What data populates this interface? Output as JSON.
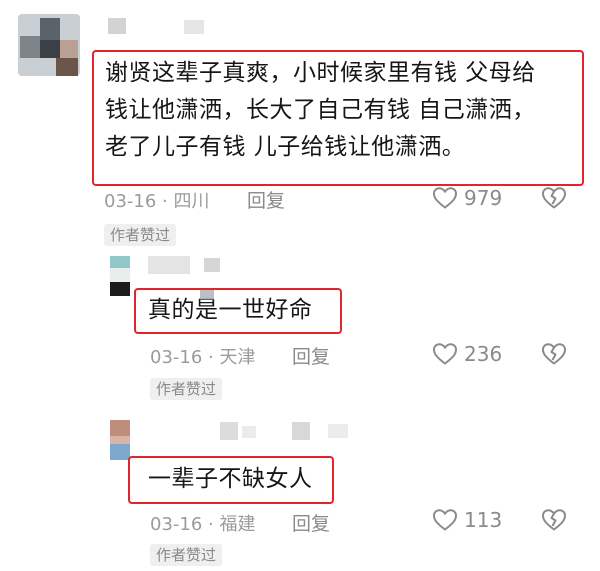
{
  "comments": [
    {
      "text_lines": [
        "谢贤这辈子真爽，小时候家里有钱 父母给",
        "钱让他潇洒，长大了自己有钱 自己潇洒，",
        "老了儿子有钱 儿子给钱让他潇洒。"
      ],
      "date_location": "03-16 · 四川",
      "reply_label": "回复",
      "like_count": "979",
      "badge": "作者赞过"
    },
    {
      "text": "真的是一世好命",
      "date_location": "03-16 · 天津",
      "reply_label": "回复",
      "like_count": "236",
      "badge": "作者赞过"
    },
    {
      "text": "一辈子不缺女人",
      "date_location": "03-16 · 福建",
      "reply_label": "回复",
      "like_count": "113",
      "badge": "作者赞过"
    }
  ],
  "colors": {
    "highlight_border": "#e0262b",
    "meta_text": "#9b9b9b",
    "badge_bg": "#efefef"
  },
  "icons": [
    "heart-outline-icon",
    "broken-heart-icon"
  ]
}
